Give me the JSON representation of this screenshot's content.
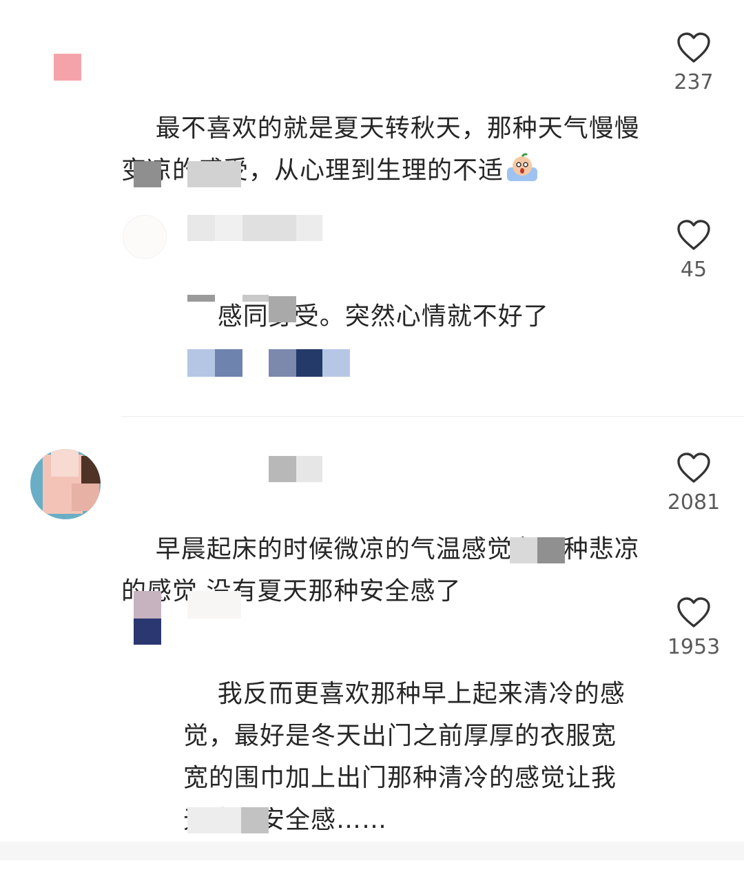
{
  "comments": [
    {
      "text": "最不喜欢的就是夏天转秋天，那种天气慢慢变凉的感受，从心理到生理的不适",
      "emoji": "crying-face-emoji",
      "likes": "237",
      "reply": {
        "text": "感同身受。突然心情就不好了",
        "likes": "45"
      }
    },
    {
      "text": "早晨起床的时候微凉的气温感觉有一种悲凉的感觉 没有夏天那种安全感了",
      "likes": "2081",
      "reply": {
        "text": "我反而更喜欢那种早上起来清冷的感觉，最好是冬天出门之前厚厚的衣服宽宽的围巾加上出门那种清冷的感觉让我无比有安全感……",
        "likes": "1953"
      }
    }
  ],
  "colors": {
    "heart_stroke": "#333333",
    "text": "#262626",
    "count": "#5a5a5a",
    "divider": "#ececec"
  },
  "icons": [
    "heart-outline-icon",
    "crying-face-emoji"
  ]
}
